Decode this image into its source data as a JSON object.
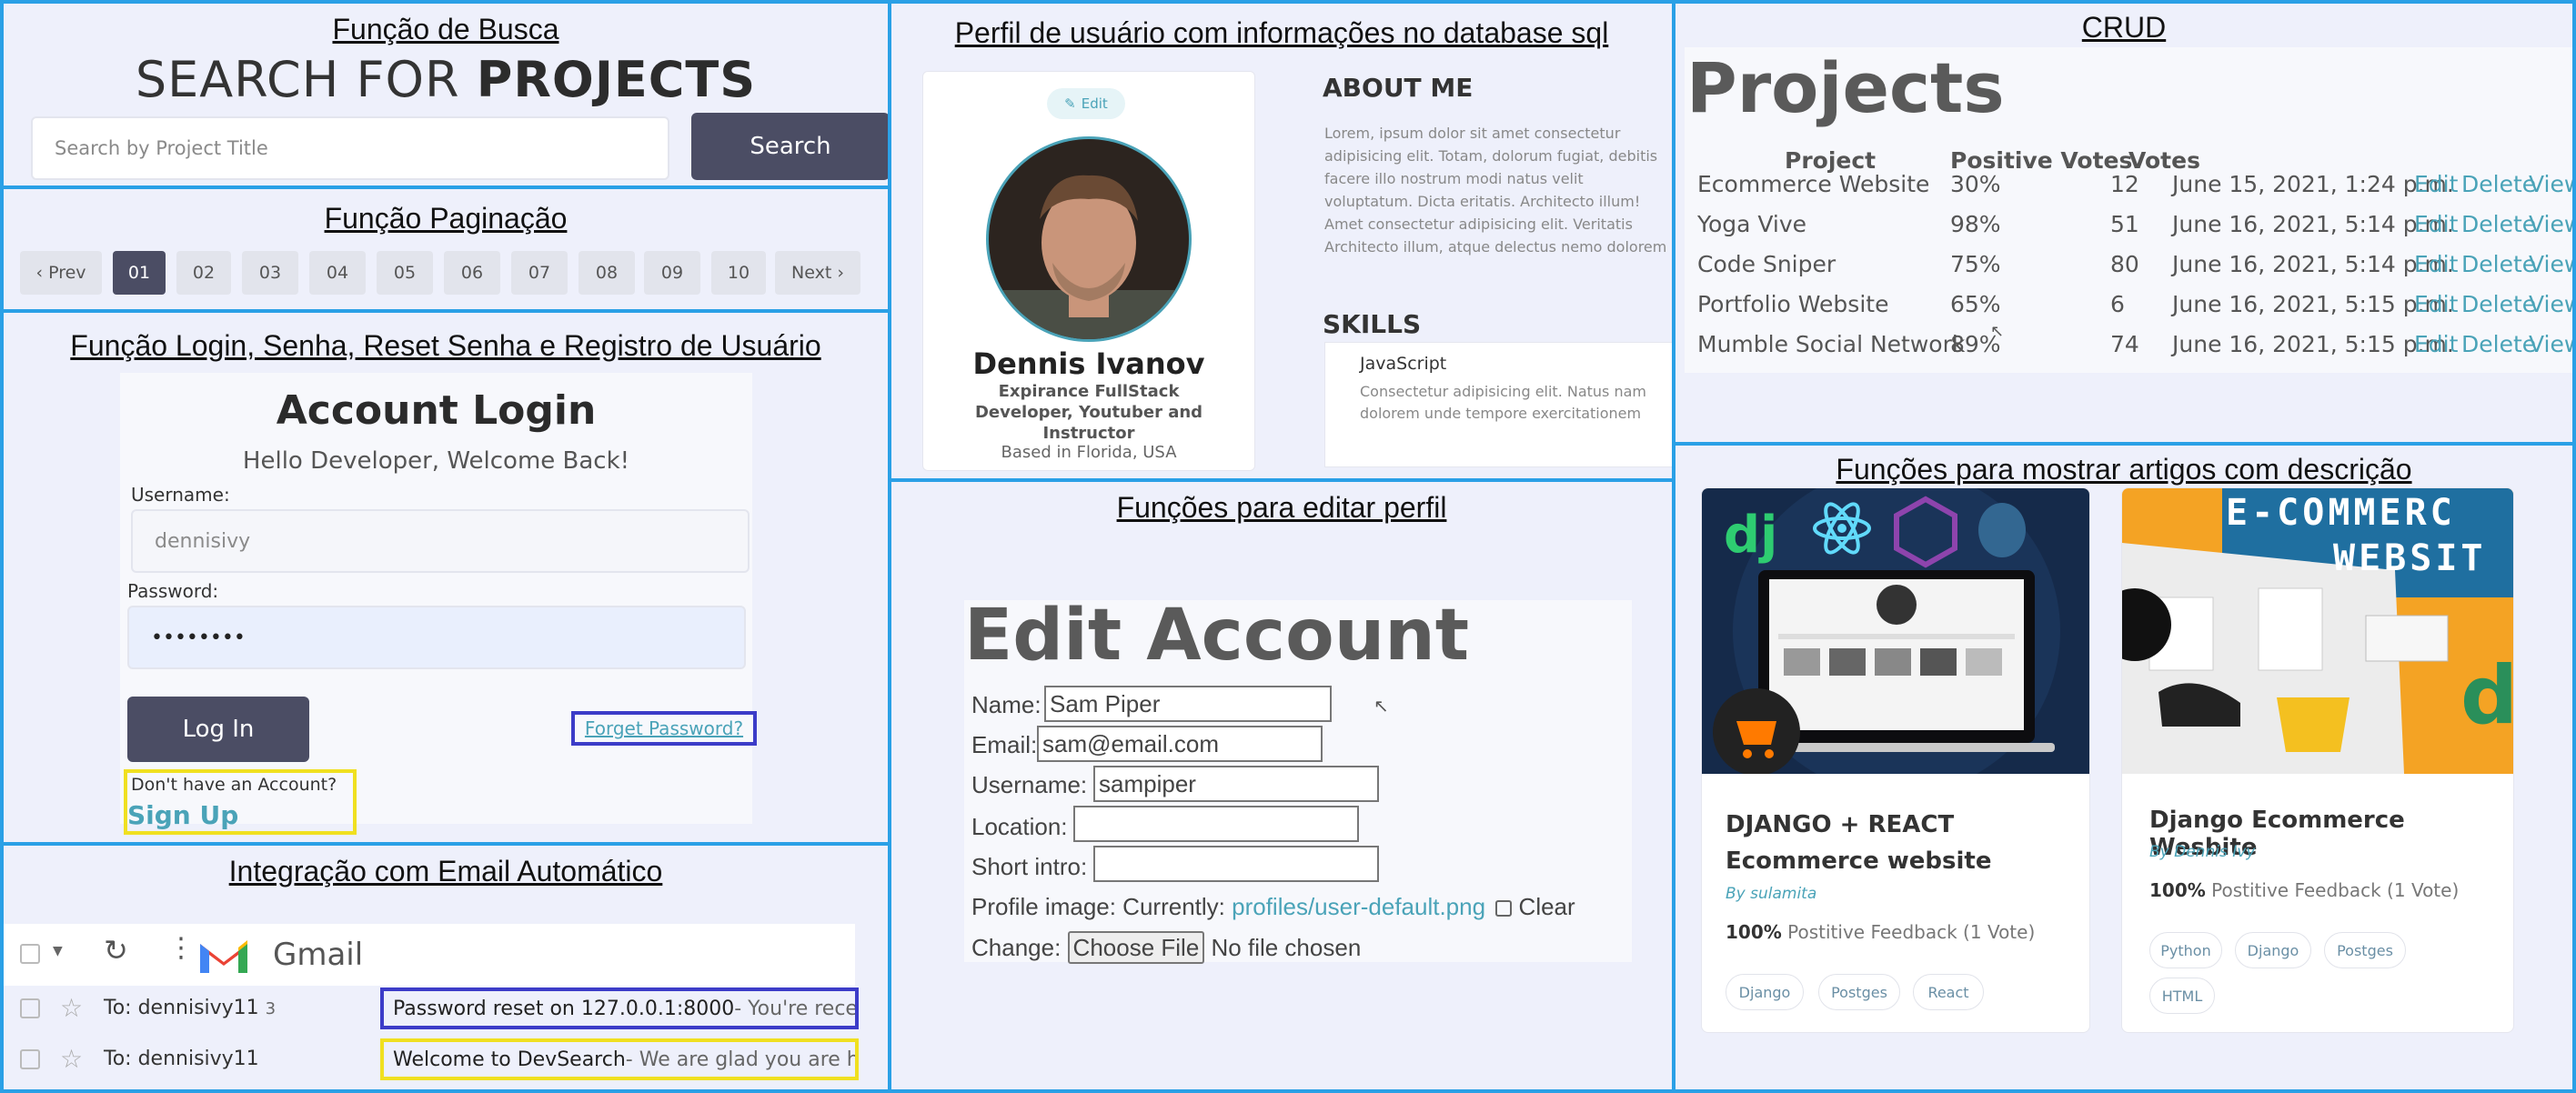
{
  "panels": {
    "search": "Função de Busca",
    "pagination": "Função Paginação",
    "login": "Função Login, Senha, Reset Senha e Registro de Usuário",
    "email": "Integração com Email Automático",
    "profile": "Perfil de usuário com informações no database sql",
    "edit": "Funções para editar perfil",
    "crud": "CRUD",
    "articles": "Funções para mostrar artigos com descrição"
  },
  "search": {
    "heading_light": "SEARCH FOR ",
    "heading_bold": "PROJECTS",
    "placeholder": "Search by Project Title",
    "button": "Search"
  },
  "pagination": {
    "prev": "‹ Prev",
    "pages": [
      "01",
      "02",
      "03",
      "04",
      "05",
      "06",
      "07",
      "08",
      "09",
      "10"
    ],
    "active": "01",
    "next": "Next ›"
  },
  "login": {
    "title": "Account Login",
    "subtitle": "Hello Developer, Welcome Back!",
    "username_label": "Username:",
    "username_value": "dennisivy",
    "password_label": "Password:",
    "password_value": "••••••••",
    "login_button": "Log In",
    "forgot": "Forget Password?",
    "no_account": "Don't have an Account?",
    "signup": "Sign Up"
  },
  "gmail": {
    "app": "Gmail",
    "rows": [
      {
        "to": "To: dennisivy11",
        "count": "3",
        "subject": "Password reset on 127.0.0.1:8000",
        "snippet": " - You're receivin"
      },
      {
        "to": "To: dennisivy11",
        "count": "",
        "subject": "Welcome to DevSearch",
        "snippet": " - We are glad you are here!"
      }
    ]
  },
  "profile": {
    "edit": "Edit",
    "name": "Dennis Ivanov",
    "headline": "Expirance FullStack Developer, Youtuber and Instructor",
    "location": "Based in Florida, USA",
    "about_title": "ABOUT ME",
    "about_p1": "Lorem, ipsum dolor sit amet consectetur adipisicing elit. Totam, dolorum fugiat, debitis facere illo nostrum modi natus velit voluptatum. Dicta eritatis. Architecto illum!",
    "about_p2": "Amet consectetur adipisicing elit. Veritatis Architecto illum, atque delectus nemo dolorem",
    "skills_title": "SKILLS",
    "skill_name": "JavaScript",
    "skill_desc": "Consectetur adipisicing elit. Natus nam dolorem unde tempore exercitationem fugiat?..."
  },
  "crud": {
    "title": "Projects",
    "headers": [
      "Project",
      "Positive Votes",
      "Votes"
    ],
    "rows": [
      {
        "project": "Ecommerce Website",
        "positive": "30%",
        "votes": "12",
        "date": "June 15, 2021, 1:24 p.m."
      },
      {
        "project": "Yoga Vive",
        "positive": "98%",
        "votes": "51",
        "date": "June 16, 2021, 5:14 p.m."
      },
      {
        "project": "Code Sniper",
        "positive": "75%",
        "votes": "80",
        "date": "June 16, 2021, 5:14 p.m."
      },
      {
        "project": "Portfolio Website",
        "positive": "65%",
        "votes": "6",
        "date": "June 16, 2021, 5:15 p.m."
      },
      {
        "project": "Mumble Social Network",
        "positive": "89%",
        "votes": "74",
        "date": "June 16, 2021, 5:15 p.m."
      }
    ],
    "actions": [
      "Edit",
      "Delete",
      "View"
    ]
  },
  "edit": {
    "title": "Edit Account",
    "name_label": "Name:",
    "name_value": "Sam Piper",
    "email_label": "Email:",
    "email_value": "sam@email.com",
    "username_label": "Username:",
    "username_value": "sampiper",
    "location_label": "Location:",
    "intro_label": "Short intro:",
    "image_label": "Profile image: Currently:",
    "image_link": "profiles/user-default.png",
    "clear": "Clear",
    "change_label": "Change:",
    "choose_file": "Choose File",
    "no_file": "No file chosen"
  },
  "articles": [
    {
      "title1": "DJANGO + REACT",
      "title2": "Ecommerce website",
      "by": "By sulamita",
      "pct": "100%",
      "feedback": " Postitive Feedback (1 Vote)",
      "tags": [
        "Django",
        "Postges",
        "React"
      ],
      "thumb_logo": "dj"
    },
    {
      "title1": "Django Ecommerce Wesbite",
      "title2": "",
      "by": "By Dennis Ivy",
      "pct": "100%",
      "feedback": " Postitive Feedback (1 Vote)",
      "tags": [
        "Python",
        "Django",
        "Postges",
        "HTML"
      ],
      "thumb_banner": "E-COMMERC",
      "thumb_banner2": "WEBSIT",
      "thumb_logo": "dj"
    }
  ],
  "colors": {
    "accent": "#2aa0e6",
    "dark_button": "#4b4d64",
    "link": "#4aa3b8",
    "blue_box": "#3c3cc8",
    "yellow_box": "#f0e020"
  }
}
